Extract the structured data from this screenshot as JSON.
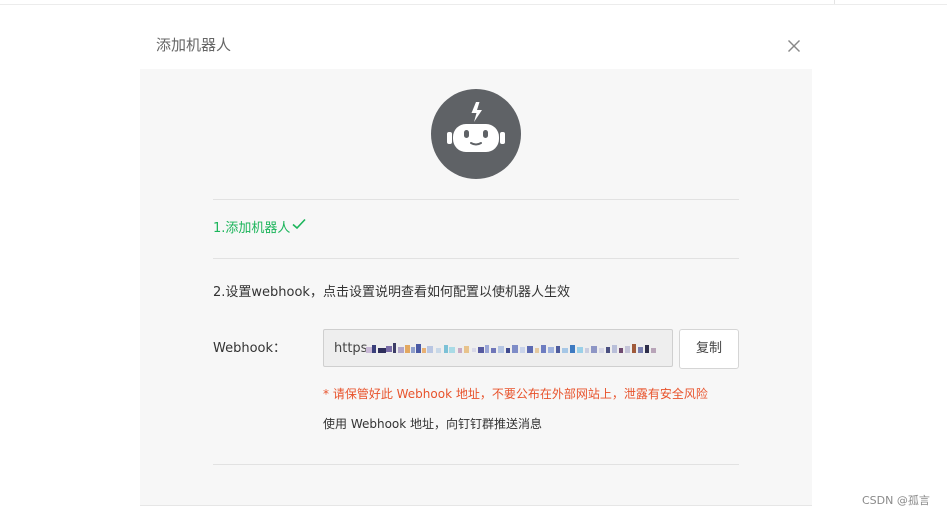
{
  "dialog": {
    "title": "添加机器人",
    "close_icon": "close-icon"
  },
  "avatar": {
    "icon": "robot-icon",
    "color": "#5f6266"
  },
  "steps": {
    "step1_label": "1.添加机器人",
    "step1_icon": "checkmark-icon",
    "step1_color": "#1cb55b",
    "step2_label": "2.设置webhook，点击设置说明查看如何配置以使机器人生效"
  },
  "webhook": {
    "label": "Webhook：",
    "value_visible_prefix": "https",
    "value_obscured": true,
    "copy_label": "复制",
    "warning": "* 请保管好此 Webhook 地址，不要公布在外部网站上，泄露有安全风险",
    "warning_color": "#e8532c",
    "usage": "使用 Webhook 地址，向钉钉群推送消息"
  },
  "watermark": "CSDN @孤言"
}
